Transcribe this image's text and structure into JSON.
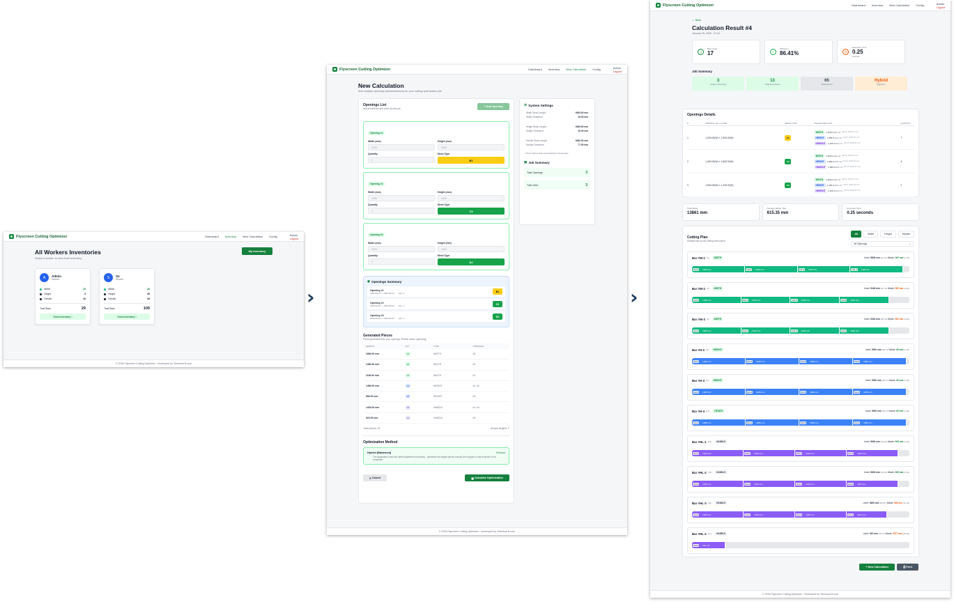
{
  "app": {
    "brand": "Flyscreen Cutting Optimizer",
    "nav": [
      "Dashboard",
      "Inventory",
      "New Calculation",
      "Config"
    ],
    "user": "Admin",
    "logout": "Logout",
    "footer": "© 2026 Flyscreen Cutting Optimizer · Developed by Technical B.com"
  },
  "colors": {
    "brand": "#15803d",
    "width": "#10b981",
    "height": "#3b82f6",
    "handle": "#8b5cf6",
    "b1": "#facc15",
    "waste_red": "#ea580c"
  },
  "inventories": {
    "title": "All Workers Inventories",
    "subtitle": "Select a worker to view their inventory",
    "my_inventory": "My Inventory",
    "workers": [
      {
        "initial": "A",
        "name": "Admin",
        "role": "Worker",
        "avatar": "#2563eb",
        "stats": [
          {
            "label": "Width",
            "value": "15"
          },
          {
            "label": "Height",
            "value": "4"
          },
          {
            "label": "Handle",
            "value": "10"
          }
        ],
        "total_label": "Total Bars",
        "total": "29",
        "button": "View Inventory ›"
      },
      {
        "initial": "S",
        "name": "Sa",
        "role": "Worker",
        "avatar": "#2563eb",
        "stats": [
          {
            "label": "Width",
            "value": "46"
          },
          {
            "label": "Height",
            "value": "45"
          },
          {
            "label": "Handle",
            "value": "18"
          }
        ],
        "total_label": "Total Bars",
        "total": "109",
        "button": "View Inventory ›"
      }
    ]
  },
  "newcalc": {
    "title": "New Calculation",
    "subtitle": "Add multiple openings (windows/doors) for your cutting optimization job",
    "openings_title": "Openings List",
    "openings_sub": "Add all windows and doors for this job",
    "add_button": "Add Opening",
    "openings": [
      {
        "label": "Opening #1",
        "width_label": "Width (mm)",
        "width": "1200",
        "height_label": "Height (mm)",
        "height": "1500",
        "qty_label": "Quantity",
        "qty": "1",
        "mesh_label": "Mesh Type",
        "mesh": "B1",
        "mesh_color": "#facc15",
        "mesh_text": "#111827"
      },
      {
        "label": "Opening #2",
        "width_label": "Width (mm)",
        "width": "1500",
        "height_label": "Height (mm)",
        "height": "1500",
        "qty_label": "Quantity",
        "qty": "1",
        "mesh_label": "Mesh Type",
        "mesh": "C3",
        "mesh_color": "#16a34a",
        "mesh_text": "#ffffff"
      },
      {
        "label": "Opening #3",
        "width_label": "Width (mm)",
        "width": "2000",
        "height_label": "Height (mm)",
        "height": "1000",
        "qty_label": "Quantity",
        "qty": "1",
        "mesh_label": "Mesh Type",
        "mesh": "D2",
        "mesh_color": "#16a34a",
        "mesh_text": "#ffffff"
      }
    ],
    "system_title": "System Settings",
    "system": [
      [
        {
          "k": "Width Stock Length:",
          "v": "6000.00 mm"
        },
        {
          "k": "Width Clearance:",
          "v": "40.00 mm"
        }
      ],
      [
        {
          "k": "Height Stock Length:",
          "v": "6000.00 mm"
        },
        {
          "k": "Height Clearance:",
          "v": "20.00 mm"
        }
      ],
      [
        {
          "k": "Handle Stock Length:",
          "v": "6000.00 mm"
        },
        {
          "k": "Handle Clearance:",
          "v": "77.00 mm"
        }
      ]
    ],
    "system_note": "These settings apply automatically to all openings",
    "job_title": "Job Summary",
    "job": [
      {
        "k": "Total Openings:",
        "v": "3"
      },
      {
        "k": "Total Units:",
        "v": "3"
      }
    ],
    "summary_title": "Openings Summary",
    "summary": [
      {
        "name": "Opening #1",
        "dims": "1200.00mm × 1500.00mm",
        "qty": "Qty: 1",
        "mesh": "B1",
        "color": "#facc15",
        "text": "#111827"
      },
      {
        "name": "Opening #2",
        "dims": "1500.00mm × 1500.00mm",
        "qty": "Qty: 1",
        "mesh": "C3",
        "color": "#16a34a",
        "text": "#ffffff"
      },
      {
        "name": "Opening #3",
        "dims": "2000.00mm × 1000.00mm",
        "qty": "Qty: 1",
        "mesh": "D2",
        "color": "#16a34a",
        "text": "#ffffff"
      }
    ],
    "pieces_title": "Generated Pieces",
    "pieces_sub": "Pieces generated from your openings. Review before optimizing.",
    "pieces_headers": [
      "LENGTH",
      "QTY",
      "TYPE",
      "OPENINGS"
    ],
    "pieces": [
      [
        "1960.00 mm",
        "×2",
        "WIDTH",
        "#3"
      ],
      [
        "1460.00 mm",
        "×2",
        "WIDTH",
        "#2"
      ],
      [
        "1160.00 mm",
        "×2",
        "WIDTH",
        "#1"
      ],
      [
        "1480.00 mm",
        "×4",
        "HEIGHT",
        "#1, #2"
      ],
      [
        "980.00 mm",
        "×2",
        "HEIGHT",
        "#3"
      ],
      [
        "1423.00 mm",
        "×2",
        "HANDLE",
        "#1, #2"
      ],
      [
        "923.00 mm",
        "×1",
        "HANDLE",
        "#3"
      ]
    ],
    "total_pieces": "Total pieces: 15",
    "unique_lengths": "Unique lengths: 7",
    "method_title": "Optimization Method",
    "method_name": "Hybrid (Balanced)",
    "method_badge": "Enforced",
    "method_desc": "The application uses the Hybrid algorithm exclusively - optimizes the largest pieces exactly, then applies a fast heuristic to the remainder.",
    "cancel": "Cancel",
    "calculate": "Calculate Optimization"
  },
  "result": {
    "back": "← Back",
    "title": "Calculation Result #4",
    "date": "January 09, 2026 - 21:24",
    "stats": [
      {
        "label": "Bars Used",
        "value": "17",
        "unit": "",
        "color": "#15803d"
      },
      {
        "label": "Efficiency",
        "value": "86.41%",
        "unit": "",
        "color": "#16a34a"
      },
      {
        "label": "Execution Time",
        "value": "0.25",
        "unit": "seconds",
        "color": "#ea580c"
      }
    ],
    "job_title": "Job Summary",
    "job": [
      {
        "value": "3",
        "label": "Unique Openings",
        "bg": "#dcfce7",
        "fg": "#15803d"
      },
      {
        "value": "13",
        "label": "Total Flyscreens",
        "bg": "#dcfce7",
        "fg": "#15803d"
      },
      {
        "value": "65",
        "label": "Total Pieces",
        "bg": "#e5e7eb",
        "fg": "#374151"
      },
      {
        "value": "Hybrid",
        "label": "Algorithm",
        "bg": "#ffedd5",
        "fg": "#ea580c"
      }
    ],
    "openings_title": "Openings Details",
    "openings_headers": [
      "#",
      "OPENING (W × H) MM",
      "MESH TYPE",
      "PIECES PER UNIT",
      "QUANTITY"
    ],
    "openings": [
      {
        "n": "1",
        "dims": "1,200.00(W) × 1,500.00(H)",
        "mesh": "B1",
        "mcolor": "#facc15",
        "mtext": "#111827",
        "qty": "7",
        "pieces": [
          [
            "WIDTH",
            "1,160.0 mm × 2",
            "(Stock: 6000.00 mm)"
          ],
          [
            "HEIGHT",
            "1,480.0 mm × 2",
            "(Stock: 6000.00 mm)"
          ],
          [
            "HANDLE",
            "1,423.0 mm × 1",
            "(Stock: 6000.00 mm)"
          ]
        ]
      },
      {
        "n": "2",
        "dims": "1,400.00(W) × 1,500.00(H)",
        "mesh": "C3",
        "mcolor": "#16a34a",
        "mtext": "#ffffff",
        "qty": "4",
        "pieces": [
          [
            "WIDTH",
            "1,360.0 mm × 2",
            "(Stock: 6000.00 mm)"
          ],
          [
            "HEIGHT",
            "1,480.0 mm × 2",
            "(Stock: 6000.00 mm)"
          ],
          [
            "HANDLE",
            "1,180.0 mm × 1",
            "(Stock: 6000.00 mm)"
          ]
        ]
      },
      {
        "n": "3",
        "dims": "1,500.00(W) × 1,200.00(H)",
        "mesh": "C2",
        "mcolor": "#16a34a",
        "mtext": "#ffffff",
        "qty": "2",
        "pieces": [
          [
            "WIDTH",
            "1,460.0 mm × 2",
            "(Stock: 6000.00 mm)"
          ],
          [
            "HEIGHT",
            "1,180.0 mm × 2",
            "(Stock: 6000.00 mm)"
          ],
          [
            "HANDLE",
            "1,123.0 mm × 1",
            "(Stock: 6000.00 mm)"
          ]
        ]
      }
    ],
    "totals": [
      {
        "label": "Total Waste",
        "value": "13861 mm"
      },
      {
        "label": "Average Waste / Bar",
        "value": "815.35 mm"
      },
      {
        "label": "Execution Time",
        "value": "0.25 seconds"
      }
    ],
    "plan_title": "Cutting Plan",
    "plan_sub": "Detailed bar-by-bar cutting instructions",
    "filters": [
      "All",
      "Width",
      "Height",
      "Handle"
    ],
    "filter_select": "All Openings",
    "bars": [
      {
        "name": "Bar #W-1",
        "count": "(3)",
        "type": "WIDTH",
        "used": "5840 mm",
        "used_pct": "(97.3%)",
        "waste": "160 mm",
        "waste_pct": "(2.7%)",
        "waste_hi": false,
        "cuts": [
          {
            "label": "Cut 1",
            "len": "1460 mm",
            "frac": 0.243
          },
          {
            "label": "Cut 2",
            "len": "1460 mm",
            "frac": 0.243
          },
          {
            "label": "Cut 3",
            "len": "1460 mm",
            "frac": 0.243
          },
          {
            "label": "Cut 4",
            "len": "1460 mm",
            "frac": 0.243
          }
        ]
      },
      {
        "name": "Bar #W-2",
        "count": "(3)",
        "type": "WIDTH",
        "used": "5440 mm",
        "used_pct": "(90.7%)",
        "waste": "560 mm",
        "waste_pct": "(9.3%)",
        "waste_hi": true,
        "cuts": [
          {
            "label": "Cut 1",
            "len": "1360 mm",
            "frac": 0.2267
          },
          {
            "label": "Cut 2",
            "len": "1360 mm",
            "frac": 0.2267
          },
          {
            "label": "Cut 3",
            "len": "1360 mm",
            "frac": 0.2267
          },
          {
            "label": "Cut 4",
            "len": "1360 mm",
            "frac": 0.2267
          }
        ]
      },
      {
        "name": "Bar #W-3",
        "count": "(3)",
        "type": "WIDTH",
        "used": "5440 mm",
        "used_pct": "(90.7%)",
        "waste": "560 mm",
        "waste_pct": "(9.3%)",
        "waste_hi": true,
        "cuts": [
          {
            "label": "Cut 1",
            "len": "1360 mm",
            "frac": 0.2267
          },
          {
            "label": "Cut 2",
            "len": "1360 mm",
            "frac": 0.2267
          },
          {
            "label": "Cut 3",
            "len": "1360 mm",
            "frac": 0.2267
          },
          {
            "label": "Cut 4",
            "len": "1360 mm",
            "frac": 0.2267
          }
        ]
      },
      {
        "name": "Bar #H-2",
        "count": "(9)",
        "type": "HEIGHT",
        "used": "5920 mm",
        "used_pct": "(98.7%)",
        "waste": "80 mm",
        "waste_pct": "(1.3%)",
        "waste_hi": false,
        "cuts": [
          {
            "label": "Cut 1",
            "len": "1480 mm",
            "frac": 0.2467
          },
          {
            "label": "Cut 2",
            "len": "1480 mm",
            "frac": 0.2467
          },
          {
            "label": "Cut 3",
            "len": "1480 mm",
            "frac": 0.2467
          },
          {
            "label": "Cut 4",
            "len": "1480 mm",
            "frac": 0.2467
          }
        ]
      },
      {
        "name": "Bar #H-3",
        "count": "(9)",
        "type": "HEIGHT",
        "used": "5920 mm",
        "used_pct": "(98.7%)",
        "waste": "80 mm",
        "waste_pct": "(1.3%)",
        "waste_hi": false,
        "cuts": [
          {
            "label": "Cut 1",
            "len": "1480 mm",
            "frac": 0.2467
          },
          {
            "label": "Cut 2",
            "len": "1480 mm",
            "frac": 0.2467
          },
          {
            "label": "Cut 3",
            "len": "1480 mm",
            "frac": 0.2467
          },
          {
            "label": "Cut 4",
            "len": "1480 mm",
            "frac": 0.2467
          }
        ]
      },
      {
        "name": "Bar #H-4",
        "count": "(10)",
        "type": "HEIGHT",
        "used": "5920 mm",
        "used_pct": "(98.7%)",
        "waste": "80 mm",
        "waste_pct": "(1.3%)",
        "waste_hi": false,
        "cuts": [
          {
            "label": "Cut 1",
            "len": "1480 mm",
            "frac": 0.2467
          },
          {
            "label": "Cut 2",
            "len": "1480 mm",
            "frac": 0.2467
          },
          {
            "label": "Cut 3",
            "len": "1480 mm",
            "frac": 0.2467
          },
          {
            "label": "Cut 4",
            "len": "1480 mm",
            "frac": 0.2467
          }
        ]
      },
      {
        "name": "Bar #HL-1",
        "count": "(14)",
        "type": "HANDLE",
        "used": "5692 mm",
        "used_pct": "(94.9%)",
        "waste": "308 mm",
        "waste_pct": "(5.1%)",
        "waste_hi": false,
        "cuts": [
          {
            "label": "Cut 1",
            "len": "1423 mm",
            "frac": 0.2372
          },
          {
            "label": "Cut 2",
            "len": "1423 mm",
            "frac": 0.2372
          },
          {
            "label": "Cut 3",
            "len": "1423 mm",
            "frac": 0.2372
          },
          {
            "label": "Cut 4",
            "len": "1423 mm",
            "frac": 0.2372
          }
        ]
      },
      {
        "name": "Bar #HL-2",
        "count": "(15)",
        "type": "HANDLE",
        "used": "5692 mm",
        "used_pct": "(94.9%)",
        "waste": "308 mm",
        "waste_pct": "(5.1%)",
        "waste_hi": false,
        "cuts": [
          {
            "label": "Cut 1",
            "len": "1423 mm",
            "frac": 0.2372
          },
          {
            "label": "Cut 2",
            "len": "1423 mm",
            "frac": 0.2372
          },
          {
            "label": "Cut 3",
            "len": "1423 mm",
            "frac": 0.2372
          },
          {
            "label": "Cut 4",
            "len": "1423 mm",
            "frac": 0.2372
          }
        ]
      },
      {
        "name": "Bar #HL-3",
        "count": "(16)",
        "type": "HANDLE",
        "used": "5392 mm",
        "used_pct": "(89.9%)",
        "waste": "608 mm",
        "waste_pct": "(10.1%)",
        "waste_hi": true,
        "cuts": [
          {
            "label": "Cut 1",
            "len": "1423 mm",
            "frac": 0.2372
          },
          {
            "label": "Cut 2",
            "len": "1423 mm",
            "frac": 0.2372
          },
          {
            "label": "Cut 3",
            "len": "1423 mm",
            "frac": 0.2372
          },
          {
            "label": "Cut 4",
            "len": "1123 mm",
            "frac": 0.1872
          }
        ]
      },
      {
        "name": "Bar #HL-4",
        "count": "(17)",
        "type": "HANDLE",
        "used": "923 mm",
        "used_pct": "(15.4%)",
        "waste": "5077 mm",
        "waste_pct": "(84.6%)",
        "waste_hi": true,
        "cuts": [
          {
            "label": "Cut 1",
            "len": "923 mm",
            "frac": 0.1538
          }
        ]
      }
    ],
    "new_calc": "+ New Calculation",
    "print": "Print"
  }
}
